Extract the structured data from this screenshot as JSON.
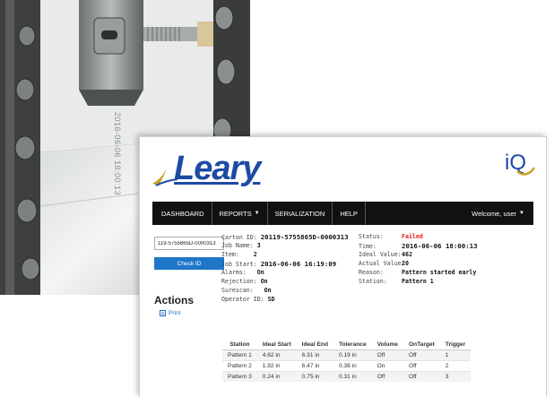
{
  "brand": {
    "name": "Leary",
    "product_logo": "iQ"
  },
  "nav": {
    "items": [
      {
        "label": "DASHBOARD",
        "dropdown": false
      },
      {
        "label": "REPORTS",
        "dropdown": true
      },
      {
        "label": "SERIALIZATION",
        "dropdown": false
      },
      {
        "label": "HELP",
        "dropdown": false
      }
    ],
    "welcome": "Welcome, user"
  },
  "search": {
    "value": "119-5755865D-0000313",
    "button_label": "Check ID"
  },
  "actions": {
    "title": "Actions",
    "print_label": "Print"
  },
  "info_left": [
    {
      "label": "Carton ID:",
      "value": "20119-5755865D-0000313",
      "big": true
    },
    {
      "label": "Job Name:",
      "value": "3"
    },
    {
      "label": "Item:",
      "value": "2"
    },
    {
      "label": "Job Start:",
      "value": "2016-06-06 16:19:09",
      "big": true
    },
    {
      "label": "Alarms:",
      "value": "On"
    },
    {
      "label": "Rejection:",
      "value": "On"
    },
    {
      "label": "Surescan:",
      "value": "On"
    },
    {
      "label": "Operator ID:",
      "value": "SD"
    }
  ],
  "info_right": [
    {
      "label": "Status:",
      "value": "Failed",
      "status": "failed"
    },
    {
      "label": "Time:",
      "value": "2016-06-06 18:00:13",
      "big": true
    },
    {
      "label": "Ideal Value:",
      "value": "462"
    },
    {
      "label": "Actual Value:",
      "value": "20"
    },
    {
      "label": "Reason:",
      "value": "Pattern started early"
    },
    {
      "label": "Station:",
      "value": "Pattern 1"
    }
  ],
  "table": {
    "headers": [
      "Station",
      "Ideal Start",
      "Ideal End",
      "Tolerance",
      "Volume",
      "OnTarget",
      "Trigger"
    ],
    "rows": [
      [
        "Pattern 1",
        "4.62 in",
        "6.31 in",
        "0.19 in",
        "Off",
        "Off",
        "1"
      ],
      [
        "Pattern 2",
        "1.92 in",
        "6.47 in",
        "0.38 in",
        "On",
        "Off",
        "2"
      ],
      [
        "Pattern 3",
        "0.24 in",
        "0.75 in",
        "0.31 in",
        "Off",
        "Off",
        "3"
      ]
    ]
  },
  "photo": {
    "imprint_text": "2016-06-06 18:00:13"
  },
  "colors": {
    "nav_bg": "#111111",
    "accent_blue": "#1f77c9",
    "logo_blue": "#1d4aa3",
    "status_failed": "#e32020",
    "logo_gold": "#c9a227"
  }
}
